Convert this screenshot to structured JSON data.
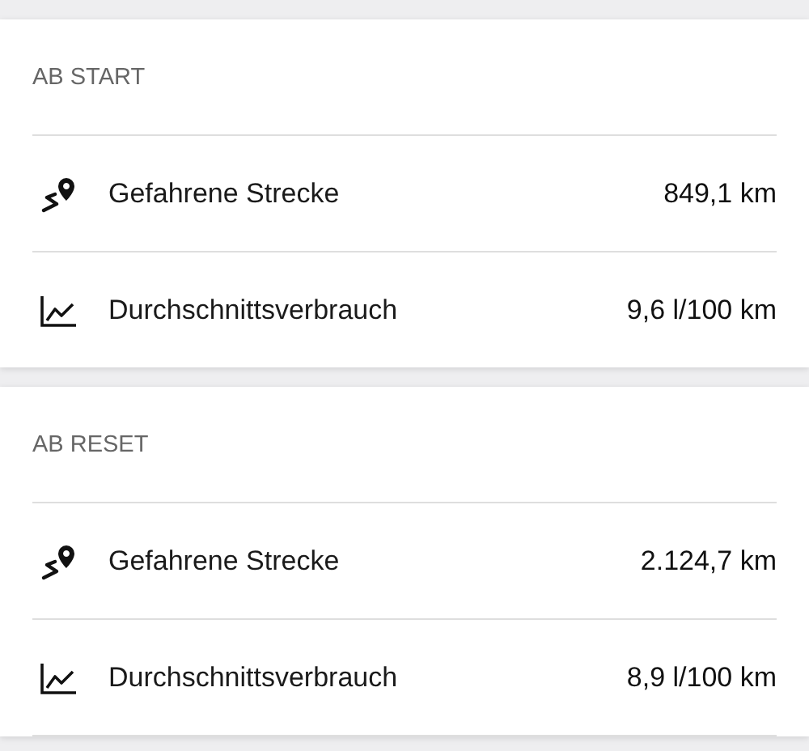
{
  "sections": [
    {
      "title": "AB START",
      "rows": [
        {
          "kind": "distance",
          "label": "Gefahrene Strecke",
          "value": "849,1 km"
        },
        {
          "kind": "consumption",
          "label": "Durchschnittsverbrauch",
          "value": "9,6 l/100 km"
        }
      ]
    },
    {
      "title": "AB RESET",
      "rows": [
        {
          "kind": "distance",
          "label": "Gefahrene Strecke",
          "value": "2.124,7 km"
        },
        {
          "kind": "consumption",
          "label": "Durchschnittsverbrauch",
          "value": "8,9 l/100 km"
        }
      ]
    }
  ]
}
